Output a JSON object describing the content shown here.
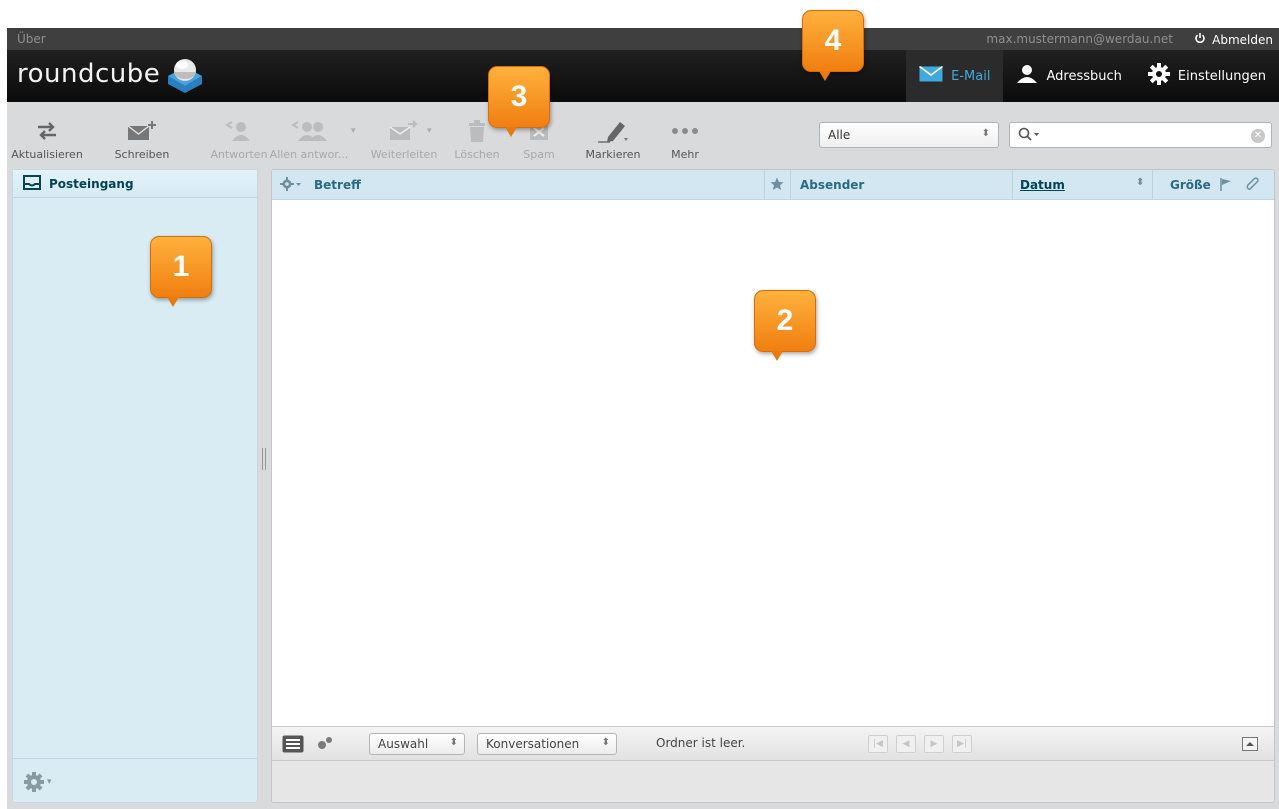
{
  "topline": {
    "about": "Über",
    "user": "max.mustermann@werdau.net",
    "logout": "Abmelden"
  },
  "logo": {
    "text": "roundcube"
  },
  "taskbar": [
    {
      "label": "E-Mail",
      "icon": "envelope-icon",
      "active": true
    },
    {
      "label": "Adressbuch",
      "icon": "person-icon",
      "active": false
    },
    {
      "label": "Einstellungen",
      "icon": "gear-icon",
      "active": false
    }
  ],
  "toolbar": {
    "refresh": "Aktualisieren",
    "compose": "Schreiben",
    "reply": "Antworten",
    "reply_all": "Allen antwor...",
    "forward": "Weiterleiten",
    "delete": "Löschen",
    "spam": "Spam",
    "mark": "Markieren",
    "more": "Mehr"
  },
  "filter": {
    "selected": "Alle"
  },
  "search": {
    "placeholder": ""
  },
  "folders": {
    "items": [
      {
        "label": "Posteingang",
        "icon": "inbox-icon",
        "selected": true
      }
    ]
  },
  "messagelist": {
    "columns": {
      "subject": "Betreff",
      "from": "Absender",
      "date": "Datum",
      "size": "Größe"
    },
    "footer": {
      "select": "Auswahl",
      "threads": "Konversationen",
      "status": "Ordner ist leer."
    }
  },
  "callouts": [
    "1",
    "2",
    "3",
    "4"
  ],
  "colors": {
    "accent": "#3fa9e0",
    "badge": "#f7931e",
    "panel": "#d9ecf4",
    "header": "#111111"
  }
}
